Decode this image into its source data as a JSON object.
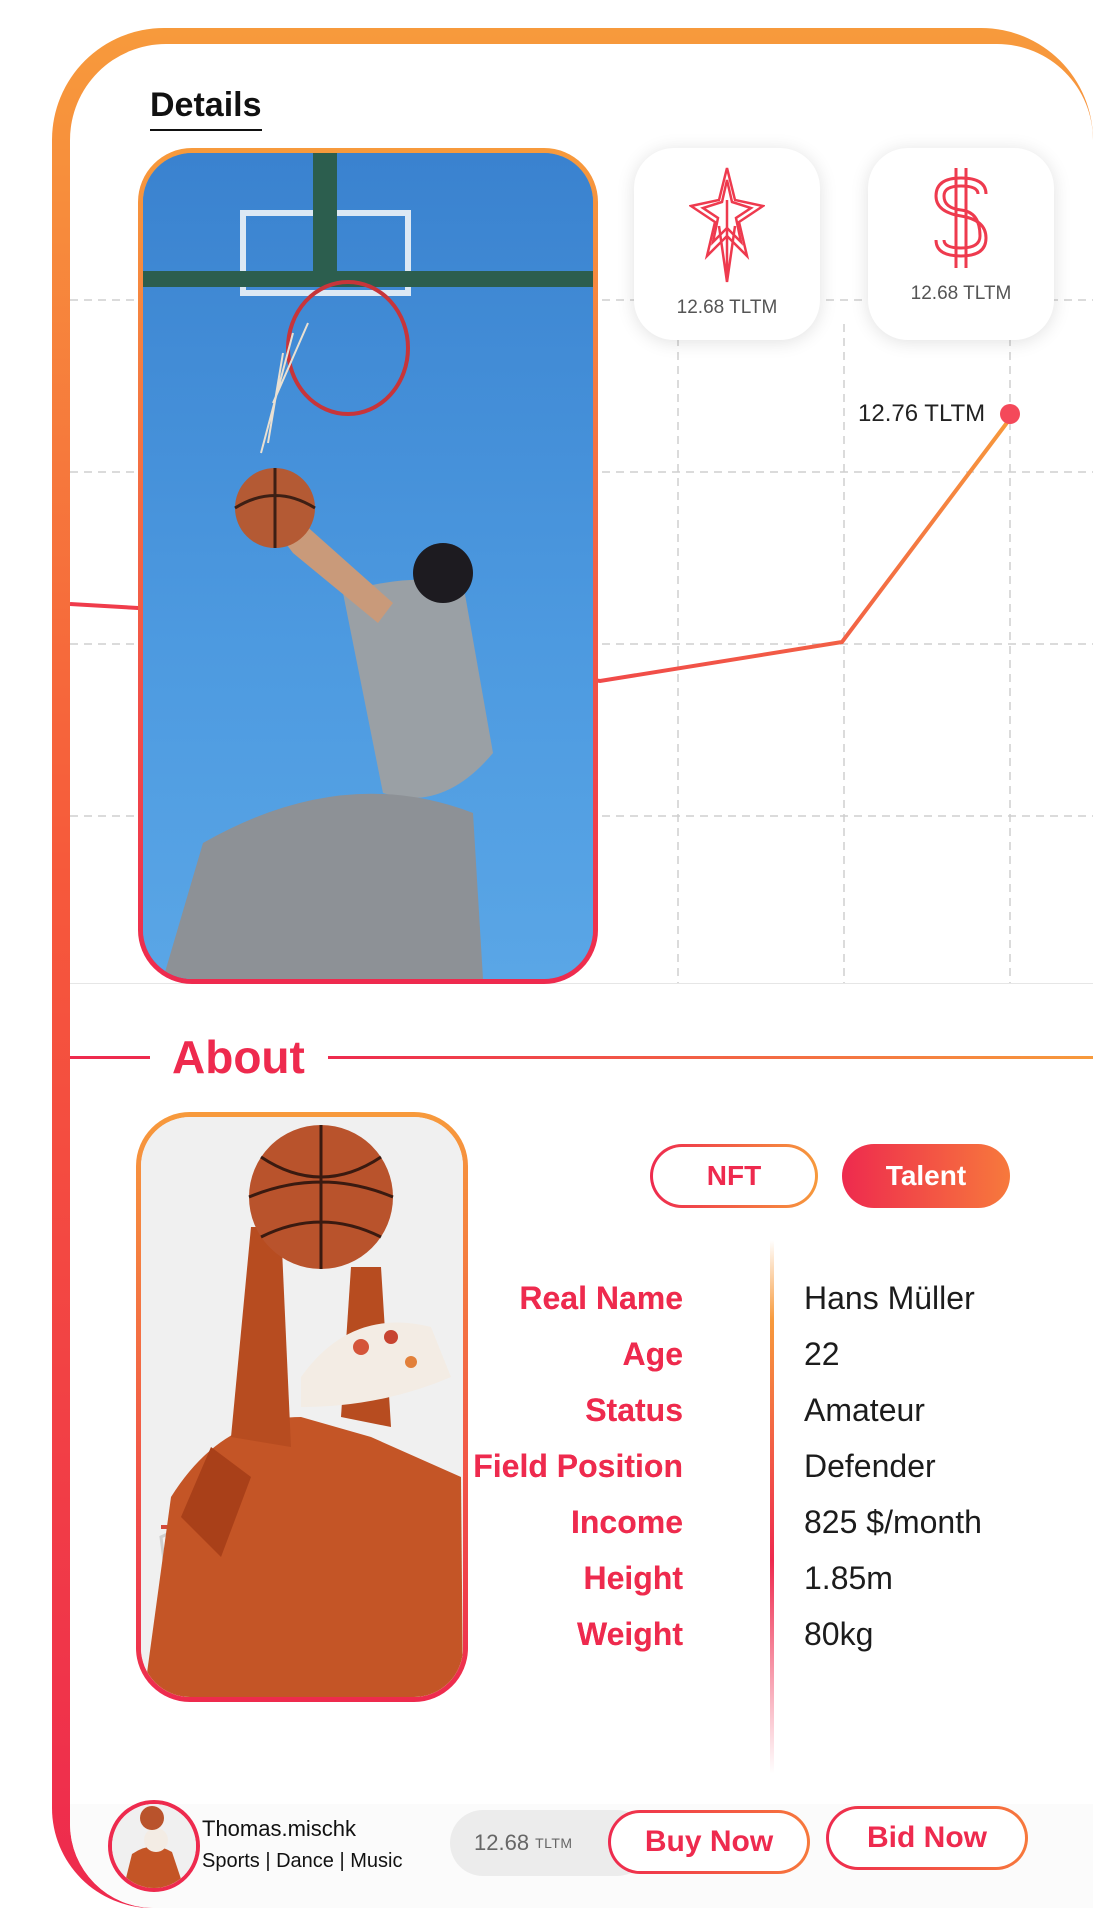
{
  "header": {
    "title": "Details"
  },
  "tokens": [
    {
      "icon": "star-icon",
      "value": "12.68 TLTM"
    },
    {
      "icon": "dollar-icon",
      "value": "12.68 TLTM"
    }
  ],
  "chart": {
    "latest_label": "12.76 TLTM"
  },
  "about": {
    "title": "About",
    "tabs": [
      {
        "label": "NFT",
        "selected": false
      },
      {
        "label": "Talent",
        "selected": true
      }
    ],
    "fields": [
      {
        "label": "Real Name",
        "value": "Hans Müller"
      },
      {
        "label": "Age",
        "value": "22"
      },
      {
        "label": "Status",
        "value": "Amateur"
      },
      {
        "label": "Field Position",
        "value": "Defender"
      },
      {
        "label": "Income",
        "value": "825 $/month"
      },
      {
        "label": "Height",
        "value": "1.85m"
      },
      {
        "label": "Weight",
        "value": "80kg"
      }
    ]
  },
  "footer": {
    "username": "Thomas.mischk",
    "categories": "Sports | Dance | Music",
    "price_value": "12.68",
    "price_unit": "TLTM",
    "buy_label": "Buy Now",
    "bid_label": "Bid Now"
  },
  "colors": {
    "accent_red": "#ee2a4e",
    "accent_orange": "#f79a3c"
  }
}
